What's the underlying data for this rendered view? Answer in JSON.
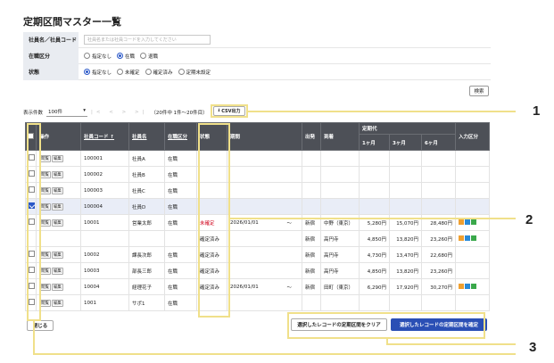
{
  "title": "定期区間マスター一覧",
  "filters": {
    "name_label": "社員名／社員コード",
    "name_placeholder": "社員名または社員コードを入力してください",
    "status_label": "在職区分",
    "status_options": [
      "指定なし",
      "在職",
      "退職"
    ],
    "status_selected": 1,
    "state_label": "状態",
    "state_options": [
      "指定なし",
      "未確定",
      "確定済み",
      "定期未設定"
    ],
    "state_selected": 0,
    "search_button": "検索"
  },
  "pager": {
    "count_label": "表示件数",
    "count_value": "100件",
    "nav": "|< < > >|",
    "range_text": "（20件中 1件〜20件目）",
    "csv_button": "CSV出力"
  },
  "table": {
    "headers": [
      "操作",
      "社員コード ↑",
      "社員名",
      "在職区分",
      "状態",
      "期間",
      "出発",
      "到着",
      "定期代",
      "1ヶ月",
      "3ヶ月",
      "6ヶ月",
      "入力区分"
    ],
    "view_label": "閲覧",
    "edit_label": "編集",
    "rows": [
      {
        "checked": false,
        "code": "100001",
        "name": "社員A",
        "status": "在職",
        "state": "",
        "period": "",
        "tilde": "",
        "from": "",
        "to": "",
        "m1": "",
        "m3": "",
        "m6": ""
      },
      {
        "checked": false,
        "code": "100002",
        "name": "社員B",
        "status": "在職",
        "state": "",
        "period": "",
        "tilde": "",
        "from": "",
        "to": "",
        "m1": "",
        "m3": "",
        "m6": ""
      },
      {
        "checked": false,
        "code": "100003",
        "name": "社員C",
        "status": "在職",
        "state": "",
        "period": "",
        "tilde": "",
        "from": "",
        "to": "",
        "m1": "",
        "m3": "",
        "m6": ""
      },
      {
        "checked": true,
        "code": "100004",
        "name": "社員D",
        "status": "在職",
        "state": "",
        "period": "",
        "tilde": "",
        "from": "",
        "to": "",
        "m1": "",
        "m3": "",
        "m6": ""
      },
      {
        "checked": false,
        "code": "10001",
        "name": "営業太郎",
        "status": "在職",
        "state": "未確定",
        "period": "2026/01/01",
        "tilde": "〜",
        "from": "新宿",
        "to": "中野（東京）",
        "m1": "5,280円",
        "m3": "15,070円",
        "m6": "28,480円",
        "icons": true,
        "red": true
      },
      {
        "checked": false,
        "code": "",
        "name": "",
        "status": "",
        "state": "確定済み",
        "period": "",
        "tilde": "",
        "from": "新宿",
        "to": "高円寺",
        "m1": "4,850円",
        "m3": "13,820円",
        "m6": "23,260円",
        "icons": true,
        "sub": true
      },
      {
        "checked": false,
        "code": "10002",
        "name": "課長次郎",
        "status": "在職",
        "state": "確定済み",
        "period": "",
        "tilde": "",
        "from": "新宿",
        "to": "高円寺",
        "m1": "4,730円",
        "m3": "13,470円",
        "m6": "22,680円"
      },
      {
        "checked": false,
        "code": "10003",
        "name": "部長三郎",
        "status": "在職",
        "state": "確定済み",
        "period": "",
        "tilde": "",
        "from": "新宿",
        "to": "高円寺",
        "m1": "4,850円",
        "m3": "13,820円",
        "m6": "23,260円"
      },
      {
        "checked": false,
        "code": "10004",
        "name": "経理花子",
        "status": "在職",
        "state": "確定済み",
        "period": "2026/01/01",
        "tilde": "〜",
        "from": "新宿",
        "to": "田町（東京）",
        "m1": "6,290円",
        "m3": "17,920円",
        "m6": "30,270円",
        "icons": true
      },
      {
        "checked": false,
        "code": "1001",
        "name": "サポ1",
        "status": "在職",
        "state": "",
        "period": "",
        "tilde": "",
        "from": "",
        "to": "",
        "m1": "",
        "m3": "",
        "m6": ""
      }
    ]
  },
  "buttons": {
    "close": "閉じる",
    "clear": "選択したレコードの定期区間をクリア",
    "confirm": "選択したレコードの定期区間を確定"
  },
  "callouts": [
    "1",
    "2",
    "3"
  ],
  "colors": {
    "accent": "#2a4fb5",
    "header": "#4d5057",
    "highlight": "#f0e08a",
    "warning": "#d0021b"
  }
}
